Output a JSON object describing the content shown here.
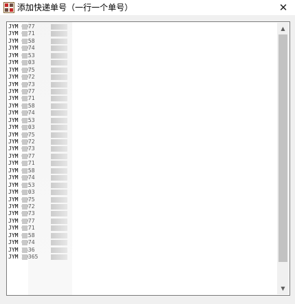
{
  "window": {
    "title": "添加快递单号（一行一个单号）",
    "close_glyph": "✕",
    "icon": "app-icon"
  },
  "textarea": {
    "lines": [
      "JYM   0977",
      "JYM   0271",
      "JYM   0258",
      "JYM   0974",
      "JYM   0253",
      "JYM   0203",
      "JYM   0975",
      "JYM   0972",
      "JYM   0973",
      "JYM   0977",
      "JYM   0271",
      "JYM   0258",
      "JYM   0974",
      "JYM   0253",
      "JYM   0203",
      "JYM   0975",
      "JYM   0972",
      "JYM   0973",
      "JYM   0977",
      "JYM   0271",
      "JYM   0258",
      "JYM   0974",
      "JYM   0253",
      "JYM   0203",
      "JYM   0975",
      "JYM   0972",
      "JYM   0973",
      "JYM   0977",
      "JYM   0271",
      "JYM   0258",
      "JYM   0974",
      "JYM   2536",
      "JYM   20365"
    ]
  },
  "scrollbar": {
    "up_glyph": "▲",
    "down_glyph": "▼"
  }
}
